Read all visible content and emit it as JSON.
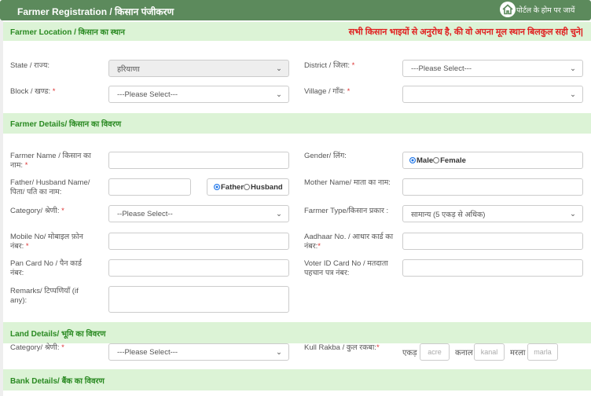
{
  "header": {
    "title": "Farmer Registration / किसान पंजीकरण",
    "home_link": "पोर्टल के होम पर जायें"
  },
  "sections": {
    "location": {
      "title": "Farmer Location / किसान का स्थान",
      "notice": "सभी किसान भाइयों से अनुरोध है, की वो अपना मूल स्थान बिलकुल सही चुने|"
    },
    "farmer": {
      "title": "Farmer Details/ किसान का विवरण"
    },
    "land": {
      "title": "Land Details/ भूमि का विवरण"
    },
    "bank": {
      "title": "Bank Details/ बैंक का विवरण"
    }
  },
  "location": {
    "state_label": "State / राज्य:",
    "state_value": "हरियाणा",
    "district_label": "District / जिला:",
    "district_value": "---Please Select---",
    "block_label": "Block / खण्ड:",
    "block_value": "---Please Select---",
    "village_label": "Village / गाँव:",
    "village_value": ""
  },
  "farmer": {
    "name_label": "Farmer Name / किसान का नाम:",
    "gender_label": "Gender/ लिंग:",
    "gender_options": [
      "Male",
      "Female"
    ],
    "father_label": "Father/ Husband Name/ पिता/ पति का नाम:",
    "relation_options": [
      "Father",
      "Husband"
    ],
    "mother_label": "Mother Name/ माता का नाम:",
    "category_label": "Category/ श्रेणी:",
    "category_value": "--Please Select--",
    "type_label": "Farmer Type/किसान प्रकार :",
    "type_value": "सामान्य (5 एकड़ से अधिक)",
    "mobile_label": "Mobile No/ मोबाइल फ़ोन नंबर:",
    "aadhaar_label": "Aadhaar No. / आधार कार्ड का नंबर:",
    "pan_label": "Pan Card No / पैन कार्ड नंबर:",
    "voter_label": "Voter ID Card No / मतदाता पहचान पत्र नंबर:",
    "remarks_label": "Remarks/ टिप्पणियाँ (if any):"
  },
  "land": {
    "category_label": "Category/ श्रेणी:",
    "category_value": "---Please Select---",
    "rakba_label": "Kull Rakba / कुल रकबा:",
    "acre_unit": "एकड़",
    "acre_placeholder": "acre",
    "kanal_unit": "कनाल",
    "kanal_placeholder": "kanal",
    "marla_unit": "मरला",
    "marla_placeholder": "marla"
  },
  "required_mark": "*",
  "colors": {
    "header": "#5c8a5c",
    "section": "#dcf3d6",
    "section_text": "#2a8a22",
    "notice": "#e02020"
  }
}
